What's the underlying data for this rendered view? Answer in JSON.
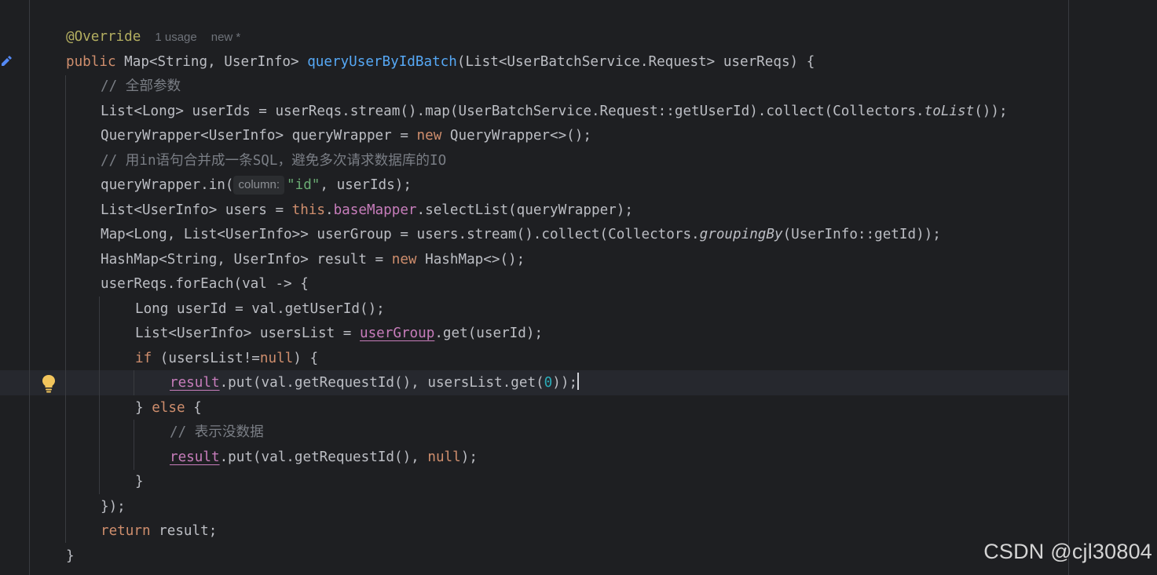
{
  "editor": {
    "meta": {
      "annotation": "@Override",
      "usages": "1 usage",
      "status": "new *"
    },
    "code": {
      "l2_kw": "public",
      "l2_type": " Map<String, UserInfo> ",
      "l2_method": "queryUserByIdBatch",
      "l2_rest": "(List<UserBatchService.Request> userReqs) {",
      "l3_comment": "// 全部参数",
      "l4_a": "List<Long> userIds = userReqs.stream().map(UserBatchService.Request::getUserId).collect(Collectors.",
      "l4_b": "toList",
      "l4_c": "());",
      "l5_a": "QueryWrapper<UserInfo> queryWrapper = ",
      "l5_kw": "new",
      "l5_b": " QueryWrapper<>();",
      "l6_comment": "// 用in语句合并成一条SQL，避免多次请求数据库的IO",
      "l7_a": "queryWrapper.in(",
      "l7_hint": "column:",
      "l7_str": "\"id\"",
      "l7_b": ", userIds);",
      "l8_a": "List<UserInfo> users = ",
      "l8_kw": "this",
      "l8_dot": ".",
      "l8_field": "baseMapper",
      "l8_b": ".selectList(queryWrapper);",
      "l9_a": "Map<Long, List<UserInfo>> userGroup = users.stream().collect(Collectors.",
      "l9_b": "groupingBy",
      "l9_c": "(UserInfo::getId));",
      "l10_a": "HashMap<String, UserInfo> result = ",
      "l10_kw": "new",
      "l10_b": " HashMap<>();",
      "l11": "userReqs.forEach(val -> {",
      "l12": "Long userId = val.getUserId();",
      "l13_a": "List<UserInfo> usersList = ",
      "l13_field": "userGroup",
      "l13_b": ".get(userId);",
      "l14_kw": "if",
      "l14_a": " (usersList!=",
      "l14_kw2": "null",
      "l14_b": ") {",
      "l15_var": "result",
      "l15_a": ".put(val.getRequestId(), usersList.get(",
      "l15_num": "0",
      "l15_b": "));",
      "l16_a": "} ",
      "l16_kw": "else",
      "l16_b": " {",
      "l17_comment": "// 表示没数据",
      "l18_var": "result",
      "l18_a": ".put(val.getRequestId(), ",
      "l18_kw": "null",
      "l18_b": ");",
      "l19": "}",
      "l20": "});",
      "l21_kw": "return",
      "l21_a": " result;",
      "l22": "}"
    }
  },
  "watermark": "CSDN @cjl30804",
  "icons": {
    "gutter_edit": "edit-marker-icon",
    "intention": "lightbulb-icon"
  },
  "colors": {
    "background": "#1e1f22",
    "keyword": "#cf8e6d",
    "annotation": "#b3ae60",
    "method": "#56a8f5",
    "string": "#6aab73",
    "number": "#2aacb8",
    "comment": "#7a7e85",
    "field": "#c77dbb"
  }
}
